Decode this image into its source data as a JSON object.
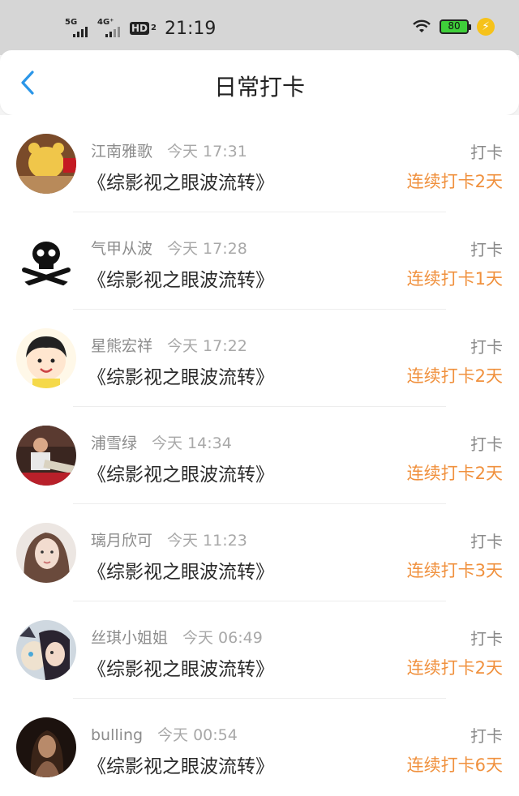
{
  "status_bar": {
    "network1": "5G",
    "network2": "4G⁺",
    "hd": "HD",
    "hd_sub": "2",
    "time": "21:19",
    "battery": "80"
  },
  "nav": {
    "title": "日常打卡"
  },
  "rows": [
    {
      "name": "江南雅歌",
      "time": "今天 17:31",
      "book": "《综影视之眼波流转》",
      "checkin": "打卡",
      "streak": "连续打卡2天"
    },
    {
      "name": "气甲从波",
      "time": "今天 17:28",
      "book": "《综影视之眼波流转》",
      "checkin": "打卡",
      "streak": "连续打卡1天"
    },
    {
      "name": "星熊宏祥",
      "time": "今天 17:22",
      "book": "《综影视之眼波流转》",
      "checkin": "打卡",
      "streak": "连续打卡2天"
    },
    {
      "name": "浦雪绿",
      "time": "今天 14:34",
      "book": "《综影视之眼波流转》",
      "checkin": "打卡",
      "streak": "连续打卡2天"
    },
    {
      "name": "璃月欣可",
      "time": "今天 11:23",
      "book": "《综影视之眼波流转》",
      "checkin": "打卡",
      "streak": "连续打卡3天"
    },
    {
      "name": "丝琪小姐姐",
      "time": "今天 06:49",
      "book": "《综影视之眼波流转》",
      "checkin": "打卡",
      "streak": "连续打卡2天"
    },
    {
      "name": "bulling",
      "time": "今天 00:54",
      "book": "《综影视之眼波流转》",
      "checkin": "打卡",
      "streak": "连续打卡6天"
    }
  ],
  "colors": {
    "accent_blue": "#2b96e8",
    "streak_orange": "#f0913e",
    "status_bar_bg": "#d6d6d6",
    "battery_green": "#3fcf3a"
  },
  "icons": [
    "back-chevron-icon",
    "signal-icon",
    "wifi-icon",
    "battery-icon",
    "charging-icon"
  ]
}
